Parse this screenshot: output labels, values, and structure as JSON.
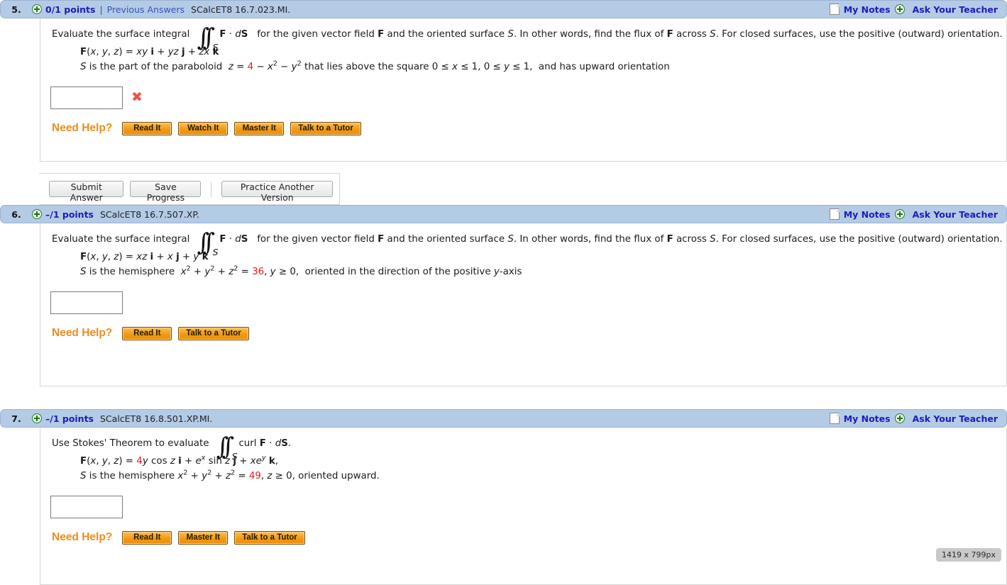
{
  "page": {
    "dimension_badge": "1419 x 799px"
  },
  "header_common": {
    "my_notes_label": "My Notes",
    "ask_teacher_label": "Ask Your Teacher",
    "note_icon": "note-page-icon",
    "plus_icon": "green-plus-circle-icon"
  },
  "questions": [
    {
      "number": "5.",
      "points": "0/1 points",
      "separator": "|",
      "previous_answers": "Previous Answers",
      "code": "SCalcET8 16.7.023.MI.",
      "prompt_before_integral": "Evaluate the surface integral",
      "integral_subscript": "S",
      "integral_body": "F · dS",
      "prompt_after_integral": "for the given vector field F and the oriented surface S. In other words, find the flux of F across S. For closed surfaces, use the positive (outward) orientation.",
      "field_line": "F(x, y, z) = xy i + yz j + zx k",
      "surface_line": "S is the part of the paraboloid z = 4 − x2 − y2 that lies above the square 0 ≤ x ≤ 1, 0 ≤ y ≤ 1,  and has upward orientation",
      "surface_red_value": "4",
      "answer_value": "",
      "answer_placeholder": "",
      "result_mark": "✖",
      "result_state": "incorrect",
      "need_help_label": "Need Help?",
      "help_buttons": [
        "Read It",
        "Watch It",
        "Master It",
        "Talk to a Tutor"
      ],
      "submit_buttons": [
        "Submit Answer",
        "Save Progress"
      ],
      "practice_button": "Practice Another Version"
    },
    {
      "number": "6.",
      "points": "–/1 points",
      "code": "SCalcET8 16.7.507.XP.",
      "prompt_before_integral": "Evaluate the surface integral",
      "integral_subscript": "S",
      "integral_body": "F · dS",
      "prompt_after_integral": "for the given vector field F and the oriented surface S. In other words, find the flux of F across S. For closed surfaces, use the positive (outward) orientation.",
      "field_line": "F(x, y, z) = xz i + x j + y k",
      "surface_line": "S is the hemisphere x2 + y2 + z2 = 36, y ≥ 0,  oriented in the direction of the positive y-axis",
      "surface_red_value": "36",
      "answer_value": "",
      "answer_placeholder": "",
      "need_help_label": "Need Help?",
      "help_buttons": [
        "Read It",
        "Talk to a Tutor"
      ]
    },
    {
      "number": "7.",
      "points": "–/1 points",
      "code": "SCalcET8 16.8.501.XP.MI.",
      "prompt_before_integral": "Use Stokes' Theorem to evaluate",
      "integral_subscript": "S",
      "integral_body": "curl F · dS.",
      "field_line": "F(x, y, z) = 4y cos z i + ex sin z j + xey k,",
      "field_red_value": "4",
      "surface_line": "S is the hemisphere x2 + y2 + z2 = 49, z ≥ 0, oriented upward.",
      "surface_red_value": "49",
      "answer_value": "",
      "answer_placeholder": "",
      "need_help_label": "Need Help?",
      "help_buttons": [
        "Read It",
        "Master It",
        "Talk to a Tutor"
      ]
    }
  ]
}
